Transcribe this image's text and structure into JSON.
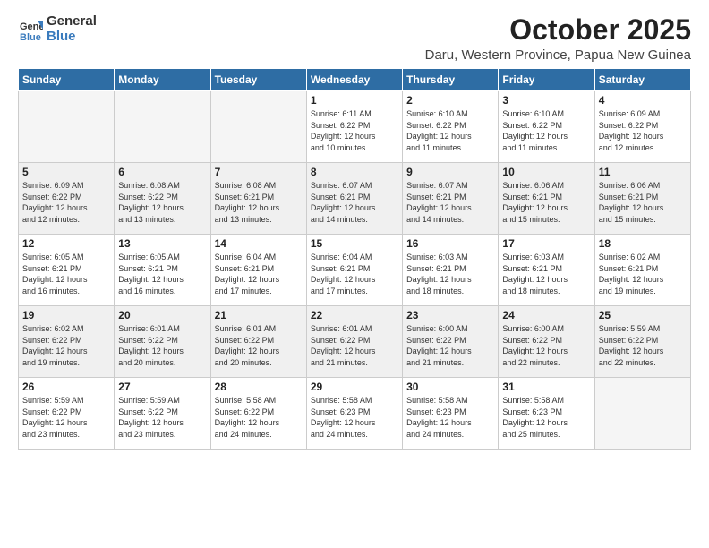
{
  "header": {
    "logo_general": "General",
    "logo_blue": "Blue",
    "month": "October 2025",
    "location": "Daru, Western Province, Papua New Guinea"
  },
  "days_of_week": [
    "Sunday",
    "Monday",
    "Tuesday",
    "Wednesday",
    "Thursday",
    "Friday",
    "Saturday"
  ],
  "weeks": [
    [
      {
        "day": "",
        "info": ""
      },
      {
        "day": "",
        "info": ""
      },
      {
        "day": "",
        "info": ""
      },
      {
        "day": "1",
        "info": "Sunrise: 6:11 AM\nSunset: 6:22 PM\nDaylight: 12 hours\nand 10 minutes."
      },
      {
        "day": "2",
        "info": "Sunrise: 6:10 AM\nSunset: 6:22 PM\nDaylight: 12 hours\nand 11 minutes."
      },
      {
        "day": "3",
        "info": "Sunrise: 6:10 AM\nSunset: 6:22 PM\nDaylight: 12 hours\nand 11 minutes."
      },
      {
        "day": "4",
        "info": "Sunrise: 6:09 AM\nSunset: 6:22 PM\nDaylight: 12 hours\nand 12 minutes."
      }
    ],
    [
      {
        "day": "5",
        "info": "Sunrise: 6:09 AM\nSunset: 6:22 PM\nDaylight: 12 hours\nand 12 minutes."
      },
      {
        "day": "6",
        "info": "Sunrise: 6:08 AM\nSunset: 6:22 PM\nDaylight: 12 hours\nand 13 minutes."
      },
      {
        "day": "7",
        "info": "Sunrise: 6:08 AM\nSunset: 6:21 PM\nDaylight: 12 hours\nand 13 minutes."
      },
      {
        "day": "8",
        "info": "Sunrise: 6:07 AM\nSunset: 6:21 PM\nDaylight: 12 hours\nand 14 minutes."
      },
      {
        "day": "9",
        "info": "Sunrise: 6:07 AM\nSunset: 6:21 PM\nDaylight: 12 hours\nand 14 minutes."
      },
      {
        "day": "10",
        "info": "Sunrise: 6:06 AM\nSunset: 6:21 PM\nDaylight: 12 hours\nand 15 minutes."
      },
      {
        "day": "11",
        "info": "Sunrise: 6:06 AM\nSunset: 6:21 PM\nDaylight: 12 hours\nand 15 minutes."
      }
    ],
    [
      {
        "day": "12",
        "info": "Sunrise: 6:05 AM\nSunset: 6:21 PM\nDaylight: 12 hours\nand 16 minutes."
      },
      {
        "day": "13",
        "info": "Sunrise: 6:05 AM\nSunset: 6:21 PM\nDaylight: 12 hours\nand 16 minutes."
      },
      {
        "day": "14",
        "info": "Sunrise: 6:04 AM\nSunset: 6:21 PM\nDaylight: 12 hours\nand 17 minutes."
      },
      {
        "day": "15",
        "info": "Sunrise: 6:04 AM\nSunset: 6:21 PM\nDaylight: 12 hours\nand 17 minutes."
      },
      {
        "day": "16",
        "info": "Sunrise: 6:03 AM\nSunset: 6:21 PM\nDaylight: 12 hours\nand 18 minutes."
      },
      {
        "day": "17",
        "info": "Sunrise: 6:03 AM\nSunset: 6:21 PM\nDaylight: 12 hours\nand 18 minutes."
      },
      {
        "day": "18",
        "info": "Sunrise: 6:02 AM\nSunset: 6:21 PM\nDaylight: 12 hours\nand 19 minutes."
      }
    ],
    [
      {
        "day": "19",
        "info": "Sunrise: 6:02 AM\nSunset: 6:22 PM\nDaylight: 12 hours\nand 19 minutes."
      },
      {
        "day": "20",
        "info": "Sunrise: 6:01 AM\nSunset: 6:22 PM\nDaylight: 12 hours\nand 20 minutes."
      },
      {
        "day": "21",
        "info": "Sunrise: 6:01 AM\nSunset: 6:22 PM\nDaylight: 12 hours\nand 20 minutes."
      },
      {
        "day": "22",
        "info": "Sunrise: 6:01 AM\nSunset: 6:22 PM\nDaylight: 12 hours\nand 21 minutes."
      },
      {
        "day": "23",
        "info": "Sunrise: 6:00 AM\nSunset: 6:22 PM\nDaylight: 12 hours\nand 21 minutes."
      },
      {
        "day": "24",
        "info": "Sunrise: 6:00 AM\nSunset: 6:22 PM\nDaylight: 12 hours\nand 22 minutes."
      },
      {
        "day": "25",
        "info": "Sunrise: 5:59 AM\nSunset: 6:22 PM\nDaylight: 12 hours\nand 22 minutes."
      }
    ],
    [
      {
        "day": "26",
        "info": "Sunrise: 5:59 AM\nSunset: 6:22 PM\nDaylight: 12 hours\nand 23 minutes."
      },
      {
        "day": "27",
        "info": "Sunrise: 5:59 AM\nSunset: 6:22 PM\nDaylight: 12 hours\nand 23 minutes."
      },
      {
        "day": "28",
        "info": "Sunrise: 5:58 AM\nSunset: 6:22 PM\nDaylight: 12 hours\nand 24 minutes."
      },
      {
        "day": "29",
        "info": "Sunrise: 5:58 AM\nSunset: 6:23 PM\nDaylight: 12 hours\nand 24 minutes."
      },
      {
        "day": "30",
        "info": "Sunrise: 5:58 AM\nSunset: 6:23 PM\nDaylight: 12 hours\nand 24 minutes."
      },
      {
        "day": "31",
        "info": "Sunrise: 5:58 AM\nSunset: 6:23 PM\nDaylight: 12 hours\nand 25 minutes."
      },
      {
        "day": "",
        "info": ""
      }
    ]
  ]
}
